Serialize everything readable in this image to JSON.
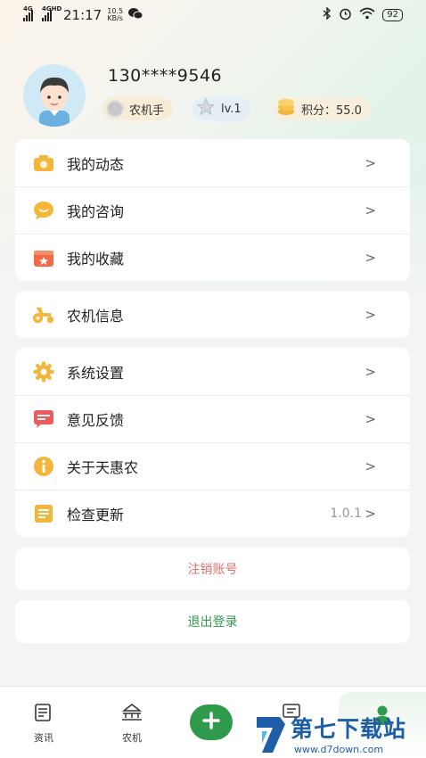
{
  "status_bar": {
    "signal1": "4G",
    "signal2": "4GHD",
    "time": "21:17",
    "net_speed_value": "10.5",
    "net_speed_unit": "KB/s",
    "battery": "92"
  },
  "profile": {
    "phone": "130****9546",
    "role": "农机手",
    "level": "lv.1",
    "points": "积分：55.0"
  },
  "menu_group1": [
    {
      "label": "我的动态",
      "icon": "camera-icon",
      "color": "#f3b53a"
    },
    {
      "label": "我的咨询",
      "icon": "chat-icon",
      "color": "#f3b53a"
    },
    {
      "label": "我的收藏",
      "icon": "favorites-icon",
      "color": "#f26a45"
    }
  ],
  "menu_group2": [
    {
      "label": "农机信息",
      "icon": "tractor-icon",
      "color": "#f3b53a"
    }
  ],
  "menu_group3": [
    {
      "label": "系统设置",
      "icon": "gear-icon",
      "color": "#f3b53a"
    },
    {
      "label": "意见反馈",
      "icon": "feedback-icon",
      "color": "#ef5b5b"
    },
    {
      "label": "关于天惠农",
      "icon": "info-icon",
      "color": "#f3b53a"
    },
    {
      "label": "检查更新",
      "icon": "update-icon",
      "color": "#f3b53a",
      "trail": "1.0.1"
    }
  ],
  "actions": {
    "cancel_account": "注销账号",
    "logout": "退出登录"
  },
  "colors": {
    "danger": "#e07070",
    "brand_green": "#2f9a4c",
    "logout_text": "#2f9a4c"
  },
  "tabbar": {
    "news": "资讯",
    "machinery": "农机",
    "chevron": ">"
  },
  "watermark": {
    "title": "第七下载站",
    "url": "www.d7down.com"
  }
}
